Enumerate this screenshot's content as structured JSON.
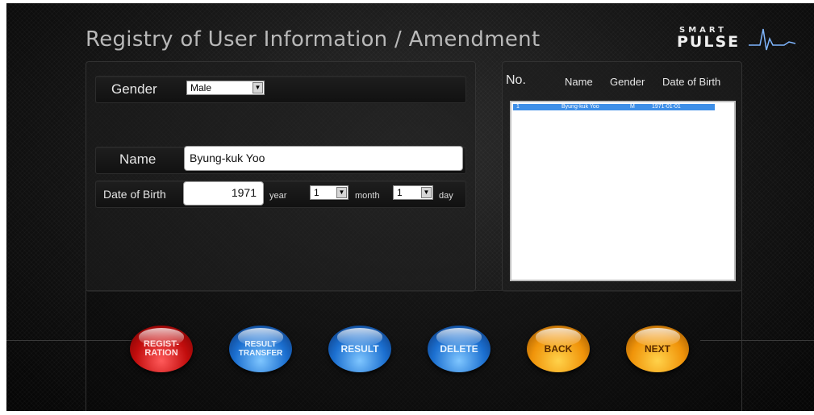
{
  "header": {
    "title": "Registry of User Information / Amendment",
    "logo_top": "SMART",
    "logo_bottom": "PULSE"
  },
  "form": {
    "gender_label": "Gender",
    "gender_value": "Male",
    "name_label": "Name",
    "name_value": "Byung-kuk Yoo",
    "dob_label": "Date of Birth",
    "year_value": "1971",
    "year_label": "year",
    "month_value": "1",
    "month_label": "month",
    "day_value": "1",
    "day_label": "day"
  },
  "list": {
    "headers": [
      "No.",
      "Name",
      "Gender",
      "Date of Birth"
    ],
    "rows": [
      {
        "no": "1",
        "name": "Byung-kuk Yoo",
        "gender": "M",
        "dob": "1971-01-01",
        "selected": true
      }
    ]
  },
  "buttons": {
    "registration": "REGIST-\nRATION",
    "result_transfer": "RESULT\nTRANSFER",
    "result": "RESULT",
    "delete": "DELETE",
    "back": "BACK",
    "next": "NEXT"
  },
  "colors": {
    "registration": "#c20d0d",
    "result_buttons": "#1b6fd0",
    "nav_buttons": "#f0940a",
    "selection": "#3e8fe8"
  }
}
